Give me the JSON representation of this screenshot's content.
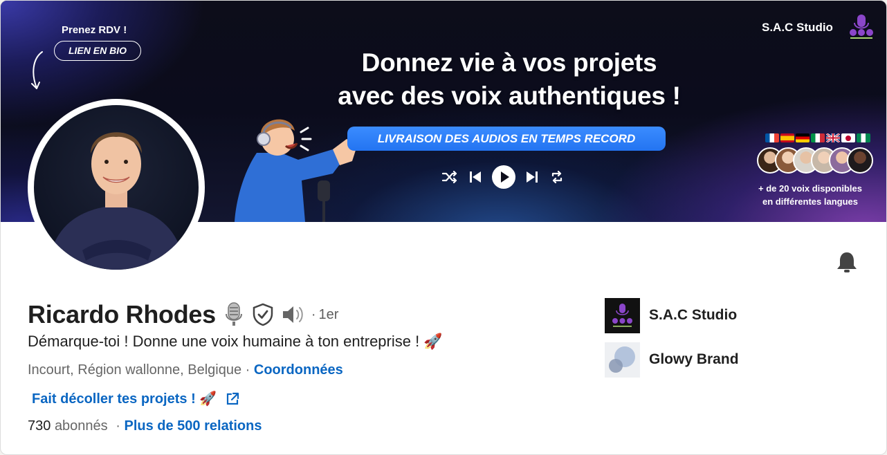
{
  "banner": {
    "cta_top": "Prenez RDV !",
    "cta_pill": "LIEN EN BIO",
    "headline_line1": "Donnez vie à vos projets",
    "headline_line2": "avec des voix authentiques !",
    "delivery_button": "LIVRAISON DES AUDIOS EN TEMPS RECORD",
    "brand_name": "S.A.C Studio",
    "voices_line1": "+ de 20 voix disponibles",
    "voices_line2": "en différentes langues",
    "player_icons": [
      "shuffle-icon",
      "previous-icon",
      "play-icon",
      "next-icon",
      "repeat-icon"
    ],
    "flags": [
      "france",
      "spain",
      "germany",
      "italy",
      "united-kingdom",
      "japan",
      "nigeria"
    ],
    "colors": {
      "cta_blue": "#2374f1",
      "background_dark": "#0d0d1a"
    }
  },
  "profile": {
    "name": "Ricardo Rhodes",
    "degree_separator": "·",
    "degree": "1er",
    "badges": [
      "microphone-icon",
      "verified-shield-icon",
      "speaker-icon"
    ],
    "headline": "Démarque-toi ! Donne une voix humaine à ton entreprise ! 🚀",
    "location": "Incourt, Région wallonne, Belgique",
    "location_separator": "·",
    "contact_link": "Coordonnées",
    "website_link": "Fait décoller tes projets ! 🚀",
    "followers_count": "730",
    "followers_label": "abonnés",
    "followers_separator": "·",
    "connections_link": "Plus de 500 relations"
  },
  "companies": [
    {
      "name": "S.A.C Studio"
    },
    {
      "name": "Glowy Brand"
    }
  ],
  "colors": {
    "link": "#0a66c2",
    "text": "#1f1f1f",
    "muted": "#666666"
  }
}
